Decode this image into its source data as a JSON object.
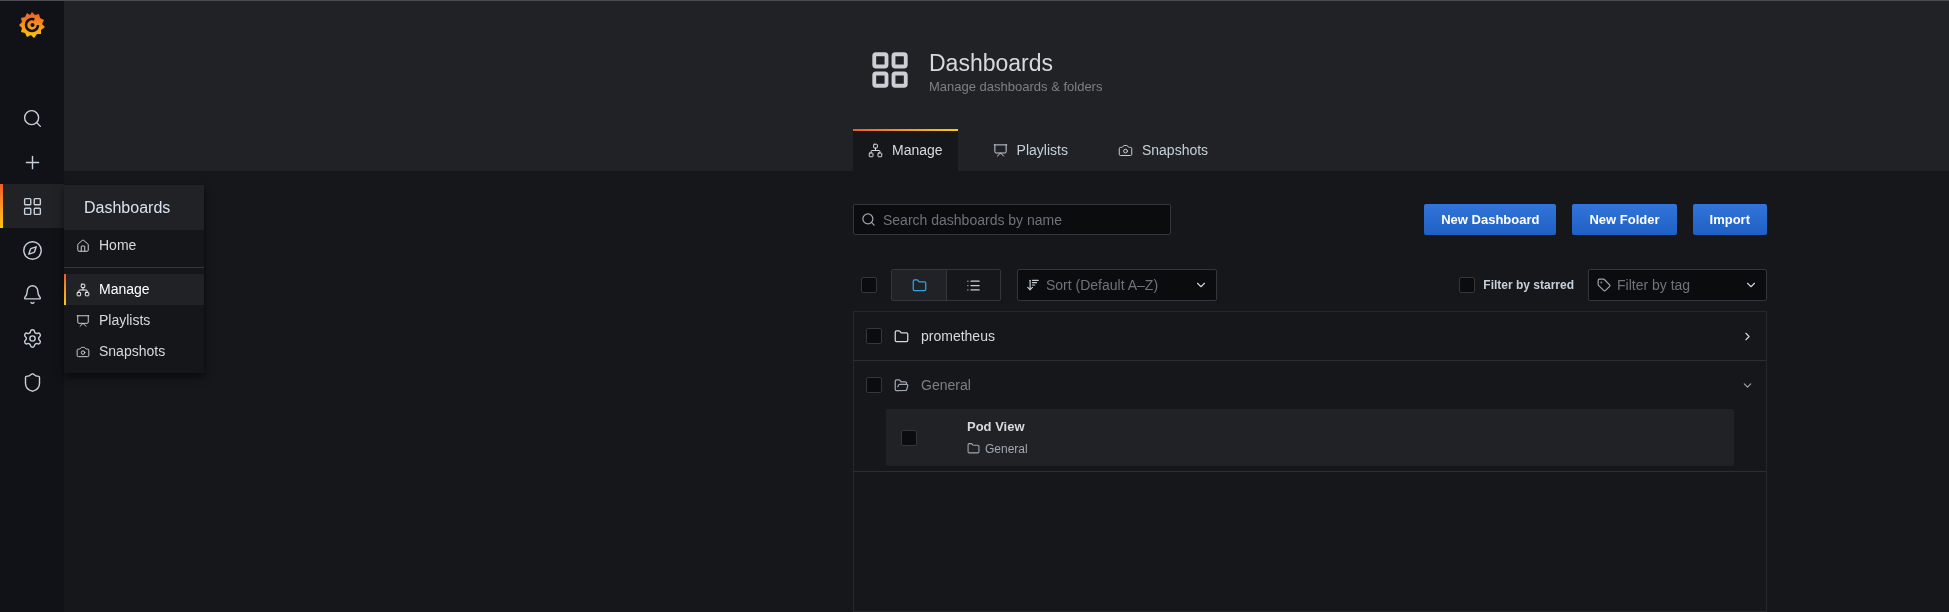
{
  "sidebar": {
    "items": [
      {
        "selected": false
      },
      {
        "selected": false
      },
      {
        "selected": true
      },
      {
        "selected": false
      },
      {
        "selected": false
      },
      {
        "selected": false
      },
      {
        "selected": false
      }
    ]
  },
  "menu": {
    "title": "Dashboards",
    "sections": [
      [
        {
          "label": "Home",
          "selected": false
        }
      ],
      [
        {
          "label": "Manage",
          "selected": true
        },
        {
          "label": "Playlists",
          "selected": false
        },
        {
          "label": "Snapshots",
          "selected": false
        }
      ]
    ]
  },
  "header": {
    "title": "Dashboards",
    "subtitle": "Manage dashboards & folders"
  },
  "tabs": [
    {
      "label": "Manage",
      "selected": true
    },
    {
      "label": "Playlists",
      "selected": false
    },
    {
      "label": "Snapshots",
      "selected": false
    }
  ],
  "search": {
    "placeholder": "Search dashboards by name"
  },
  "buttons": [
    "New Dashboard",
    "New Folder",
    "Import"
  ],
  "toolbar": {
    "select_all": {
      "checked": false
    },
    "view_toggle": [
      {
        "selected": true
      },
      {
        "selected": false
      }
    ],
    "sort": {
      "placeholder": "Sort (Default A‒Z)"
    },
    "filter_starred": {
      "label": "Filter by starred",
      "checked": false
    },
    "tag_filter": {
      "placeholder": "Filter by tag"
    }
  },
  "folders": [
    {
      "name": "prometheus",
      "checked": false,
      "expanded": false
    },
    {
      "name": "General",
      "checked": false,
      "expanded": true,
      "dashboards": [
        {
          "title": "Pod View",
          "folder": "General",
          "checked": false
        }
      ]
    }
  ]
}
